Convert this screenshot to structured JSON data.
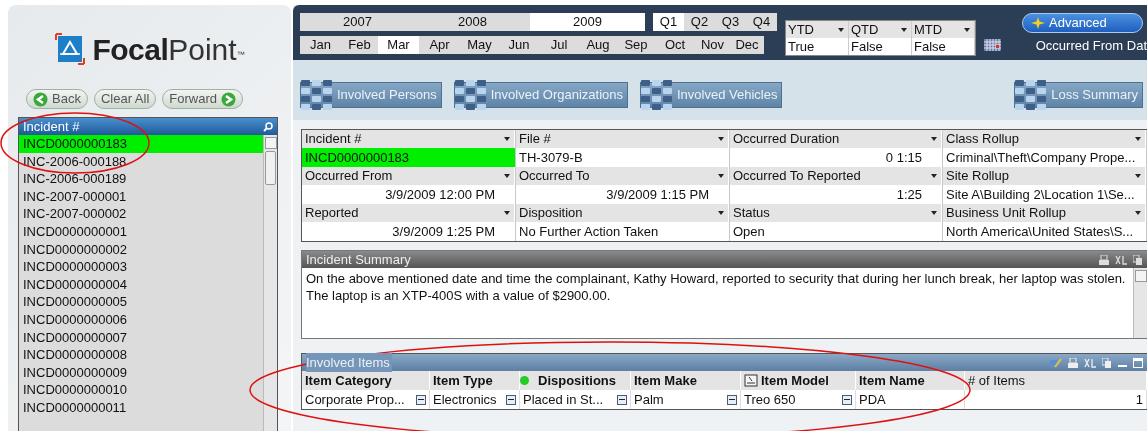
{
  "logo": {
    "bold": "Focal",
    "light": "Point",
    "mark": "™"
  },
  "nav_buttons": [
    {
      "label": "Back",
      "kind": "back"
    },
    {
      "label": "Clear All",
      "kind": "plain"
    },
    {
      "label": "Forward",
      "kind": "forward"
    }
  ],
  "incident_list": {
    "header": "Incident #",
    "items": [
      {
        "label": "INCD0000000183",
        "selected": true
      },
      {
        "label": "INC-2006-000188",
        "selected": false
      },
      {
        "label": "INC-2006-000189",
        "selected": false
      },
      {
        "label": "INC-2007-000001",
        "selected": false
      },
      {
        "label": "INC-2007-000002",
        "selected": false
      },
      {
        "label": "INCD0000000001",
        "selected": false
      },
      {
        "label": "INCD0000000002",
        "selected": false
      },
      {
        "label": "INCD0000000003",
        "selected": false
      },
      {
        "label": "INCD0000000004",
        "selected": false
      },
      {
        "label": "INCD0000000005",
        "selected": false
      },
      {
        "label": "INCD0000000006",
        "selected": false
      },
      {
        "label": "INCD0000000007",
        "selected": false
      },
      {
        "label": "INCD0000000008",
        "selected": false
      },
      {
        "label": "INCD0000000009",
        "selected": false
      },
      {
        "label": "INCD0000000010",
        "selected": false
      },
      {
        "label": "INCD0000000011",
        "selected": false
      }
    ]
  },
  "years": [
    {
      "label": "2007",
      "selected": false
    },
    {
      "label": "2008",
      "selected": false
    },
    {
      "label": "2009",
      "selected": true
    }
  ],
  "quarters": [
    {
      "label": "Q1",
      "selected": true
    },
    {
      "label": "Q2",
      "selected": false
    },
    {
      "label": "Q3",
      "selected": false
    },
    {
      "label": "Q4",
      "selected": false
    }
  ],
  "months": [
    {
      "label": "Jan",
      "selected": false
    },
    {
      "label": "Feb",
      "selected": false
    },
    {
      "label": "Mar",
      "selected": true
    },
    {
      "label": "Apr",
      "selected": false
    },
    {
      "label": "May",
      "selected": false
    },
    {
      "label": "Jun",
      "selected": false
    },
    {
      "label": "Jul",
      "selected": false
    },
    {
      "label": "Aug",
      "selected": false
    },
    {
      "label": "Sep",
      "selected": false
    },
    {
      "label": "Oct",
      "selected": false
    },
    {
      "label": "Nov",
      "selected": false
    },
    {
      "label": "Dec",
      "selected": false
    }
  ],
  "period_filters": [
    {
      "label": "YTD",
      "value": "True"
    },
    {
      "label": "QTD",
      "value": "False"
    },
    {
      "label": "MTD",
      "value": "False"
    }
  ],
  "advanced_button": "Advanced",
  "occurred_label": "Occurred From Dat",
  "tab_buttons": [
    {
      "label": "Involved Persons"
    },
    {
      "label": "Involved Organizations"
    },
    {
      "label": "Involved Vehicles"
    },
    {
      "label": "Loss Summary"
    }
  ],
  "fields": [
    {
      "label": "Incident #",
      "value": "INCD0000000183",
      "kind": "text",
      "highlight": true
    },
    {
      "label": "File #",
      "value": "TH-3079-B",
      "kind": "text",
      "highlight": false
    },
    {
      "label": "Occurred Duration",
      "value": "0 1:15",
      "kind": "time",
      "highlight": false
    },
    {
      "label": "Class Rollup",
      "value": "Criminal\\Theft\\Company Prope...",
      "kind": "text",
      "highlight": false
    },
    {
      "label": "Occurred From",
      "value": "3/9/2009 12:00 PM",
      "kind": "time",
      "highlight": false
    },
    {
      "label": "Occurred To",
      "value": "3/9/2009 1:15 PM",
      "kind": "time",
      "highlight": false
    },
    {
      "label": "Occurred To Reported",
      "value": "1:25",
      "kind": "time",
      "highlight": false
    },
    {
      "label": "Site Rollup",
      "value": "Site A\\Building 2\\Location 1\\Se...",
      "kind": "text",
      "highlight": false
    },
    {
      "label": "Reported",
      "value": "3/9/2009 1:25 PM",
      "kind": "time",
      "highlight": false
    },
    {
      "label": "Disposition",
      "value": "No Further Action Taken",
      "kind": "text",
      "highlight": false
    },
    {
      "label": "Status",
      "value": "Open",
      "kind": "text",
      "highlight": false
    },
    {
      "label": "Business Unit Rollup",
      "value": "North America\\United States\\S...",
      "kind": "text",
      "highlight": false
    }
  ],
  "summary": {
    "title": "Incident Summary",
    "paragraphs": [
      "On the above mentioned date and time the complainant, Kathy Howard, reported to security that during her lunch break, her laptop was stolen.",
      "The laptop is an XTP-400S with a value of $2900.00."
    ]
  },
  "items_panel": {
    "title": "Involved Items",
    "columns": [
      {
        "label": "Item Category",
        "kind": "plain"
      },
      {
        "label": "Item Type",
        "kind": "plain"
      },
      {
        "label": "Dispositions",
        "kind": "dot"
      },
      {
        "label": "Item Make",
        "kind": "plain"
      },
      {
        "label": "Item Model",
        "kind": "doc"
      },
      {
        "label": "Item Name",
        "kind": "plain"
      },
      {
        "label": "# of Items",
        "kind": "number"
      }
    ],
    "rows": [
      [
        "Corporate Prop...",
        "Electronics",
        "Placed in St...",
        "Palm",
        "Treo 650",
        "PDA",
        "1"
      ]
    ]
  }
}
